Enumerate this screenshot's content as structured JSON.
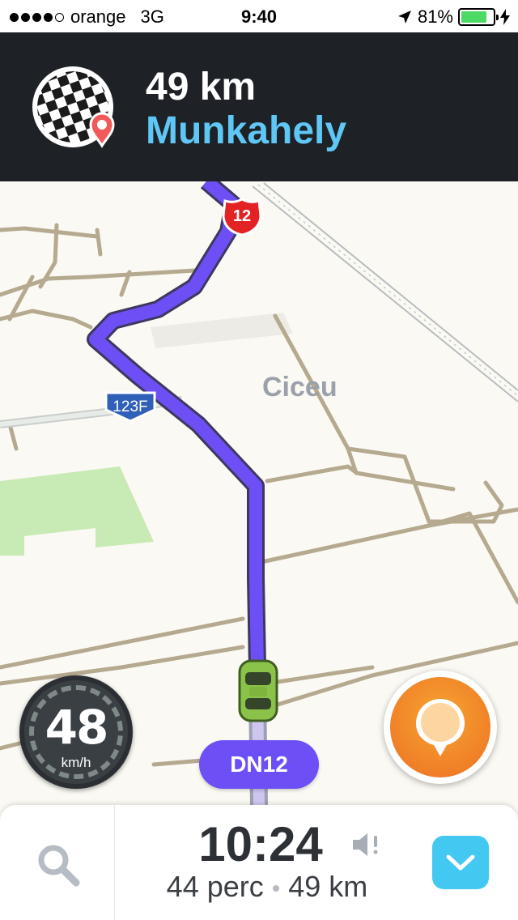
{
  "status_bar": {
    "carrier": "orange",
    "network": "3G",
    "time": "9:40",
    "battery": "81%",
    "battery_level": 0.81,
    "signal_bars_filled": 4,
    "signal_bars_total": 5,
    "icons": [
      "location-arrow-icon",
      "charging-bolt-icon"
    ]
  },
  "navigation": {
    "distance": "49 km",
    "destination": "Munkahely",
    "destination_icon": "checkered-flag-icon"
  },
  "map": {
    "city_label": "Ciceu",
    "route_shields": [
      "12",
      "123F"
    ],
    "route_color": "#6e4ff5"
  },
  "speedometer": {
    "speed": "48",
    "unit": "km/h"
  },
  "current_street": "DN12",
  "bottom_bar": {
    "eta_time": "10:24",
    "duration": "44 perc",
    "separator": "•",
    "remaining_distance": "49 km"
  },
  "colors": {
    "header_bg": "#1e2126",
    "destination_text": "#5fc7f5",
    "street_pill": "#6e4ff5",
    "report_button": "#f07f27",
    "expand_button": "#43c8f1"
  }
}
